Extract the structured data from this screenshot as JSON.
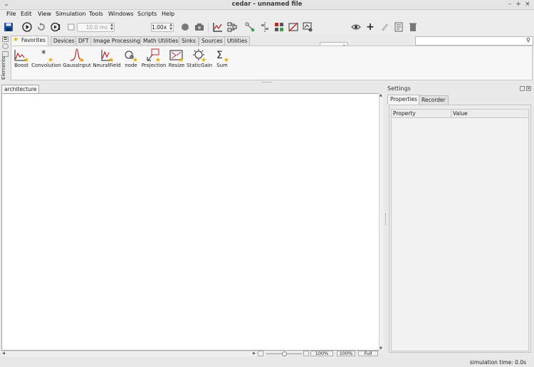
{
  "window": {
    "title": "cedar - unnamed file",
    "controls": [
      "⌄",
      "–",
      "+",
      "×"
    ]
  },
  "menu": [
    "File",
    "Edit",
    "View",
    "Simulation",
    "Tools",
    "Windows",
    "Scripts",
    "Help"
  ],
  "toolbar": {
    "step_size": "10.0 ms",
    "speed_factor": "1.00x",
    "slider_fraction": 0.45,
    "add_symbol": "+"
  },
  "elements": {
    "side_label": "Elements",
    "tabs": [
      "Favorites",
      "Devices",
      "DFT",
      "Image Processing",
      "Math Utilities",
      "Sinks",
      "Sources",
      "Utilities"
    ],
    "active_tab": "Favorites",
    "items": [
      "Boost",
      "Convolution",
      "GaussInput",
      "NeuralField",
      "node",
      "Projection",
      "Resize",
      "StaticGain",
      "Sum"
    ],
    "search_icon": "magnifier-icon"
  },
  "architecture": {
    "tab_label": "architecture",
    "zoom_value": "100%",
    "zoom_reset": "100%",
    "zoom_fit": "Full",
    "zoom_slider_fraction": 0.5
  },
  "settings": {
    "title": "Settings",
    "tabs": [
      "Properties",
      "Recorder"
    ],
    "columns": [
      "Property",
      "Value"
    ]
  },
  "status": {
    "sim_time": "simulation time: 0.0s"
  }
}
